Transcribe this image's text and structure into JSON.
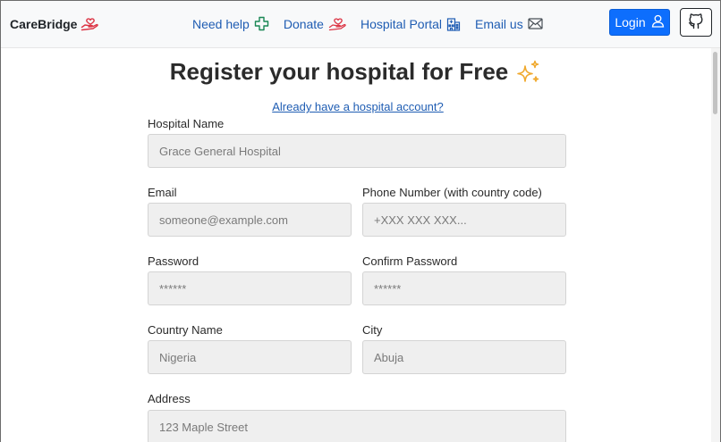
{
  "brand": {
    "name": "CareBridge",
    "icon": "heart-hand-icon",
    "color": "#dc3545"
  },
  "nav": {
    "links": [
      {
        "label": "Need help",
        "icon": "medical-cross-icon"
      },
      {
        "label": "Donate",
        "icon": "donate-hand-icon"
      },
      {
        "label": "Hospital Portal",
        "icon": "hospital-building-icon"
      },
      {
        "label": "Email us",
        "icon": "envelope-icon"
      }
    ],
    "login_label": "Login",
    "login_icon": "user-icon",
    "github_icon": "github-icon"
  },
  "colors": {
    "primary": "#0d6efd",
    "link": "#1f5db3",
    "field_bg": "#efefef",
    "accent_sparkle": "#f0a92e"
  },
  "form": {
    "title": "Register your hospital for Free",
    "title_icon": "sparkles-icon",
    "account_link": "Already have a hospital account?",
    "fields": {
      "hospital_name": {
        "label": "Hospital Name",
        "placeholder": "Grace General Hospital"
      },
      "email": {
        "label": "Email",
        "placeholder": "someone@example.com"
      },
      "phone": {
        "label": "Phone Number (with country code)",
        "placeholder": "+XXX XXX XXX..."
      },
      "password": {
        "label": "Password",
        "placeholder": "******"
      },
      "confirm_password": {
        "label": "Confirm Password",
        "placeholder": "******"
      },
      "country": {
        "label": "Country Name",
        "placeholder": "Nigeria"
      },
      "city": {
        "label": "City",
        "placeholder": "Abuja"
      },
      "address": {
        "label": "Address",
        "placeholder": "123 Maple Street"
      }
    }
  }
}
